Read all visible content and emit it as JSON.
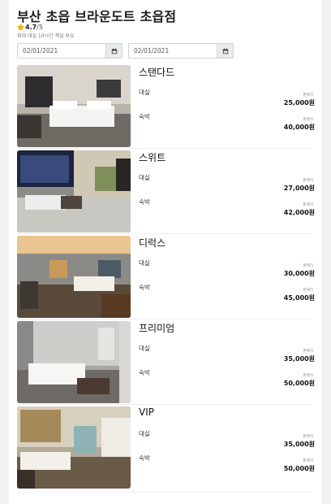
{
  "hotel": {
    "name": "부산 초읍 브라운도트 초읍점",
    "rating": "4.7",
    "rating_max": "/5",
    "policy_note": "최대 대실 10시간 객실 보유"
  },
  "dates": {
    "checkin": "02/01/2021",
    "checkout": "02/01/2021"
  },
  "price_tag": "판매가",
  "rooms": [
    {
      "name": "스탠다드",
      "plans": [
        {
          "label": "대실",
          "price": "25,000원"
        },
        {
          "label": "숙박",
          "price": "40,000원"
        }
      ]
    },
    {
      "name": "스위트",
      "plans": [
        {
          "label": "대실",
          "price": "27,000원"
        },
        {
          "label": "숙박",
          "price": "42,000원"
        }
      ]
    },
    {
      "name": "디럭스",
      "plans": [
        {
          "label": "대실",
          "price": "30,000원"
        },
        {
          "label": "숙박",
          "price": "45,000원"
        }
      ]
    },
    {
      "name": "프리미엄",
      "plans": [
        {
          "label": "대실",
          "price": "35,000원"
        },
        {
          "label": "숙박",
          "price": "50,000원"
        }
      ]
    },
    {
      "name": "VIP",
      "plans": [
        {
          "label": "대실",
          "price": "35,000원"
        },
        {
          "label": "숙박",
          "price": "50,000원"
        }
      ]
    }
  ],
  "colors": {
    "star": "#f0b400",
    "calendar_button": "#e9ecef"
  }
}
